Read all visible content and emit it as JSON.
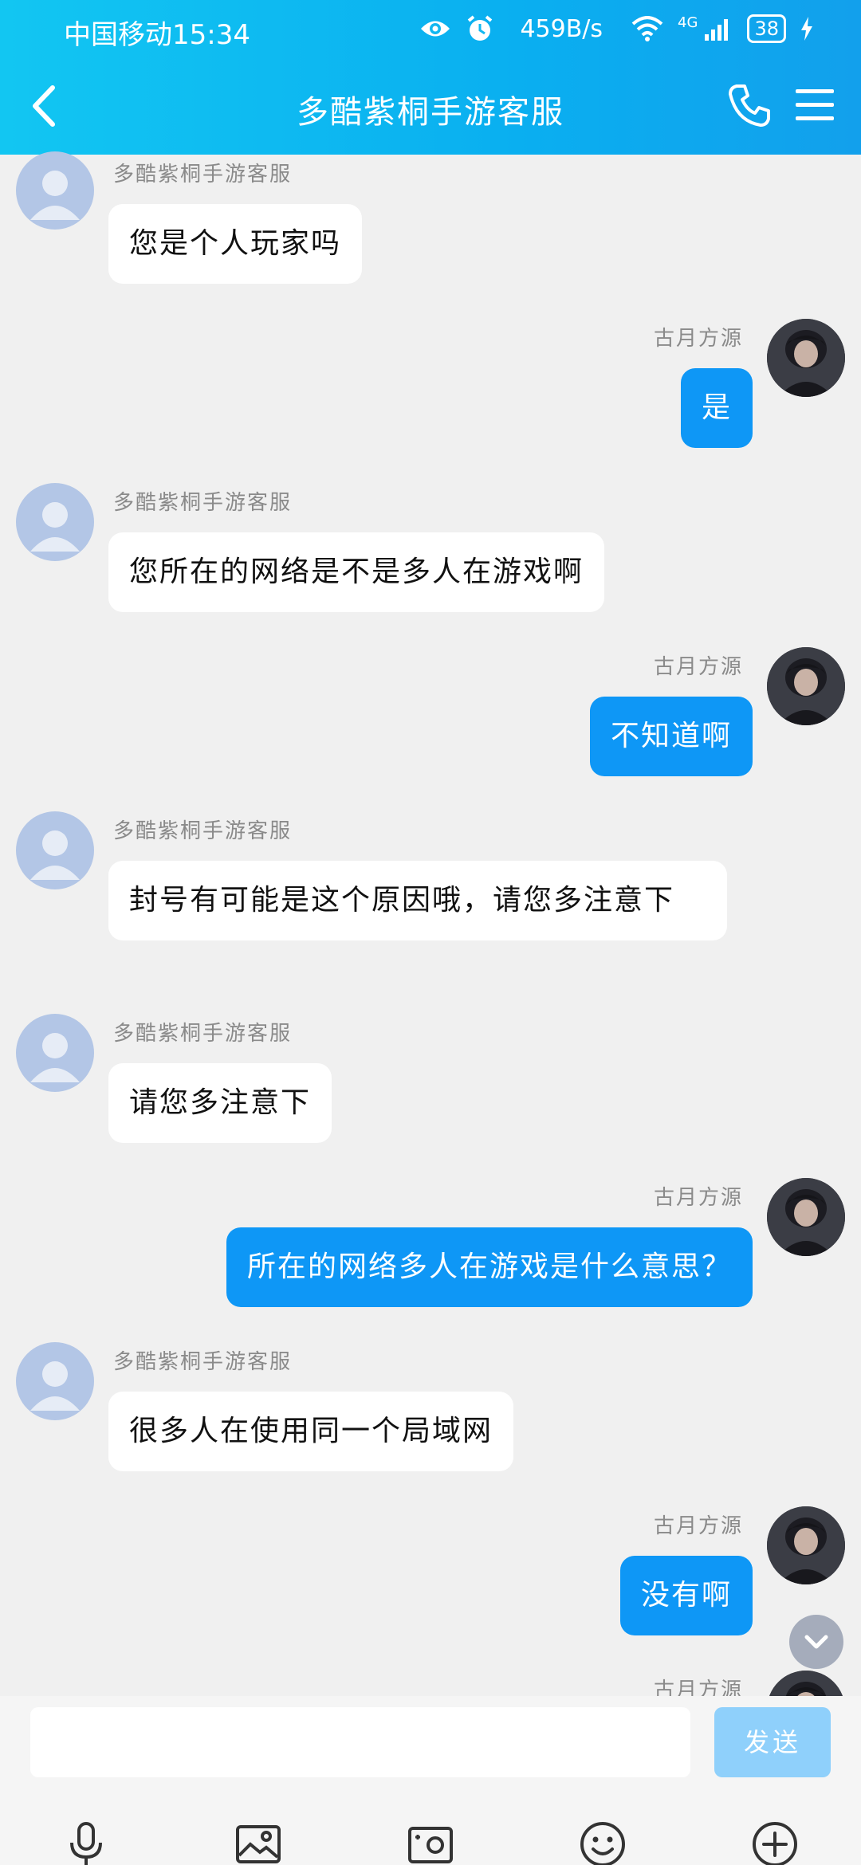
{
  "status_bar": {
    "carrier_time": "中国移动15:34",
    "net_speed": "459B/s",
    "network": "4G",
    "battery": "38"
  },
  "title_bar": {
    "title": "多酷紫桐手游客服"
  },
  "messages": [
    {
      "side": "left",
      "sender": "多酷紫桐手游客服",
      "text": "您是个人玩家吗"
    },
    {
      "side": "right",
      "sender": "古月方源",
      "text": "是"
    },
    {
      "side": "left",
      "sender": "多酷紫桐手游客服",
      "text": "您所在的网络是不是多人在游戏啊"
    },
    {
      "side": "right",
      "sender": "古月方源",
      "text": "不知道啊"
    },
    {
      "side": "left",
      "sender": "多酷紫桐手游客服",
      "text": "封号有可能是这个原因哦，请您多注意下"
    },
    {
      "side": "left",
      "sender": "多酷紫桐手游客服",
      "text": "请您多注意下"
    },
    {
      "side": "right",
      "sender": "古月方源",
      "text": "所在的网络多人在游戏是什么意思？"
    },
    {
      "side": "left",
      "sender": "多酷紫桐手游客服",
      "text": "很多人在使用同一个局域网"
    },
    {
      "side": "right",
      "sender": "古月方源",
      "text": "没有啊"
    },
    {
      "side": "right",
      "sender": "古月方源",
      "text": ""
    }
  ],
  "input_bar": {
    "placeholder": "",
    "send_label": "发送",
    "tools": [
      "microphone-icon",
      "image-icon",
      "camera-icon",
      "emoji-icon",
      "plus-icon"
    ]
  },
  "colors": {
    "header": "#0aaff0",
    "bubble_self": "#0e97f6",
    "bubble_other": "#ffffff",
    "send_disabled": "#8fd0fb",
    "background": "#f0f0f0"
  }
}
